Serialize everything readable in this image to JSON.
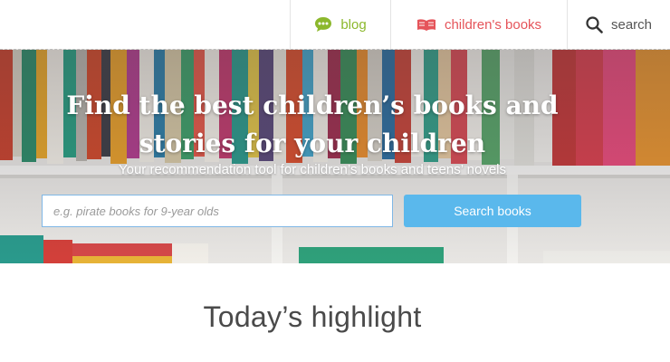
{
  "nav": {
    "blog": {
      "label": "blog",
      "icon": "speech-bubble-icon",
      "color": "#8cb82c"
    },
    "books": {
      "label": "children's books",
      "icon": "open-book-icon",
      "color": "#e5545a"
    },
    "search": {
      "label": "search",
      "icon": "magnifier-icon"
    }
  },
  "hero": {
    "title_line1": "Find the best children’s books and",
    "title_line2": "stories for your children",
    "subtitle": "Your recommendation tool for children’s books and teens’ novels",
    "search_placeholder": "e.g. pirate books for 9-year olds",
    "search_value": "",
    "search_button": "Search books",
    "button_color": "#5ab8ec"
  },
  "highlight": {
    "heading": "Today’s highlight"
  }
}
